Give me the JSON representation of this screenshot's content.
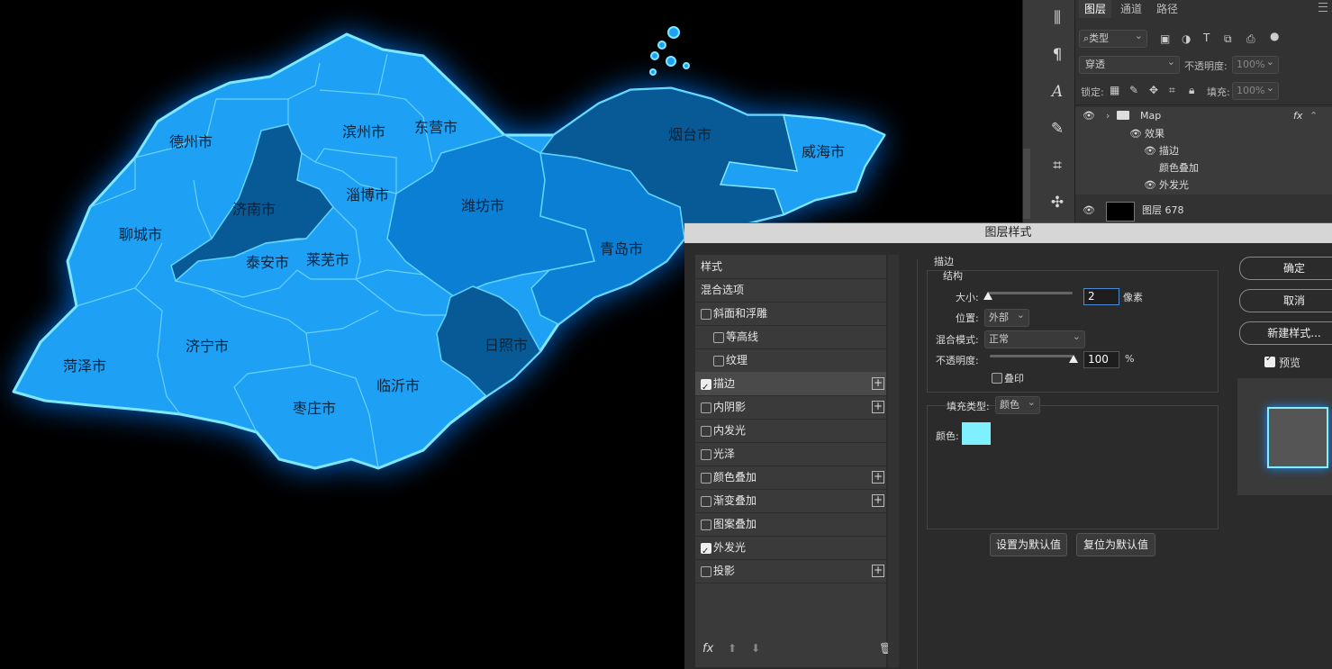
{
  "cities": {
    "dezhou": "德州市",
    "binzhou": "滨州市",
    "dongying": "东营市",
    "yantai": "烟台市",
    "weihai": "威海市",
    "jinan": "济南市",
    "zibo": "淄博市",
    "weifang": "潍坊市",
    "liaocheng": "聊城市",
    "taian": "泰安市",
    "laiwu": "莱芜市",
    "qingdao": "青岛市",
    "rizhao": "日照市",
    "jining": "济宁市",
    "heze": "菏泽市",
    "linyi": "临沂市",
    "zaozhuang": "枣庄市"
  },
  "colors": {
    "region_light": "#1ea0f4",
    "region_mid": "#0b7fd4",
    "region_dark": "#075a95",
    "stroke": "#7ee8ff",
    "glow": "#0a7dff",
    "stroke_swatch": "#7ef0ff"
  },
  "layers_panel": {
    "tabs": [
      "图层",
      "通道",
      "路径"
    ],
    "filter": "类型",
    "blend_mode": "穿透",
    "opacity_label": "不透明度:",
    "opacity_value": "100%",
    "lock_label": "锁定:",
    "fill_label": "填充:",
    "fill_value": "100%",
    "layers": [
      {
        "name": "Map",
        "fx": "fx"
      },
      {
        "name": "效果"
      },
      {
        "name": "描边"
      },
      {
        "name": "颜色叠加"
      },
      {
        "name": "外发光"
      },
      {
        "name": "图层 678"
      }
    ]
  },
  "dialog": {
    "title": "图层样式",
    "styles_header": "样式",
    "blend_options": "混合选项",
    "items": [
      {
        "label": "斜面和浮雕",
        "checked": false,
        "plus": false
      },
      {
        "label": "等高线",
        "checked": false,
        "plus": false,
        "indent": true
      },
      {
        "label": "纹理",
        "checked": false,
        "plus": false,
        "indent": true
      },
      {
        "label": "描边",
        "checked": true,
        "plus": true,
        "selected": true
      },
      {
        "label": "内阴影",
        "checked": false,
        "plus": true
      },
      {
        "label": "内发光",
        "checked": false,
        "plus": false
      },
      {
        "label": "光泽",
        "checked": false,
        "plus": false
      },
      {
        "label": "颜色叠加",
        "checked": false,
        "plus": true
      },
      {
        "label": "渐变叠加",
        "checked": false,
        "plus": true
      },
      {
        "label": "图案叠加",
        "checked": false,
        "plus": false
      },
      {
        "label": "外发光",
        "checked": true,
        "plus": false
      },
      {
        "label": "投影",
        "checked": false,
        "plus": true
      }
    ],
    "stroke": {
      "section_title": "描边",
      "structure_title": "结构",
      "size_label": "大小:",
      "size_value": "2",
      "size_unit": "像素",
      "position_label": "位置:",
      "position_value": "外部",
      "blend_label": "混合模式:",
      "blend_value": "正常",
      "opacity_label": "不透明度:",
      "opacity_value": "100",
      "opacity_unit": "%",
      "overprint_label": "叠印",
      "fill_type_label": "填充类型:",
      "fill_type_value": "颜色",
      "color_label": "颜色:",
      "set_default": "设置为默认值",
      "reset_default": "复位为默认值"
    },
    "buttons": {
      "ok": "确定",
      "cancel": "取消",
      "new_style": "新建样式...",
      "preview": "预览"
    },
    "fx_label": "fx"
  }
}
